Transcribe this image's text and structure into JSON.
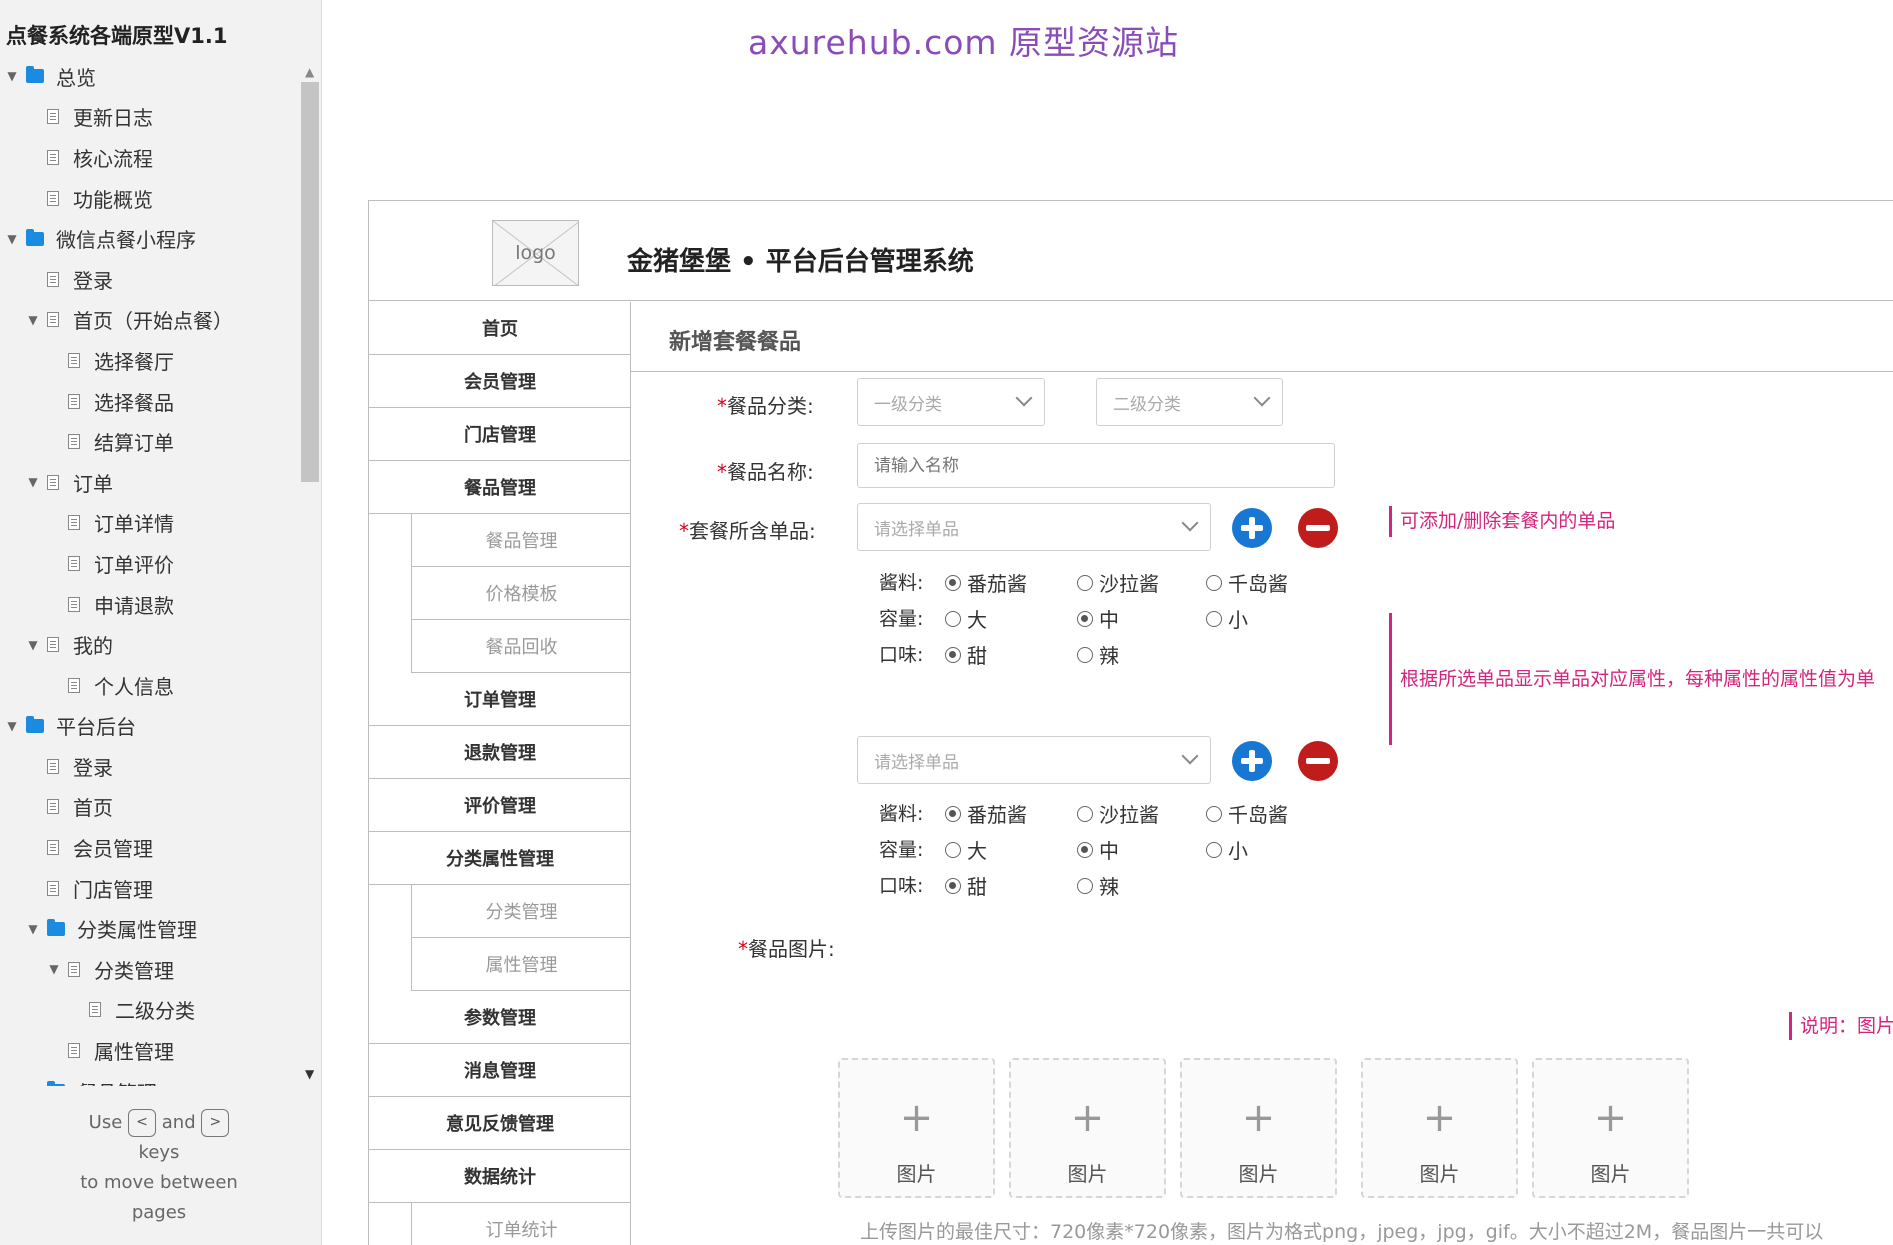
{
  "sitemap": {
    "project_title": "点餐系统各端原型V1.1",
    "nodes": [
      {
        "label": "总览",
        "type": "folder",
        "expanded": true,
        "indent": 0
      },
      {
        "label": "更新日志",
        "type": "page",
        "indent": 1
      },
      {
        "label": "核心流程",
        "type": "page",
        "indent": 1
      },
      {
        "label": "功能概览",
        "type": "page",
        "indent": 1
      },
      {
        "label": "微信点餐小程序",
        "type": "folder",
        "expanded": true,
        "indent": 0
      },
      {
        "label": "登录",
        "type": "page",
        "indent": 1
      },
      {
        "label": "首页（开始点餐）",
        "type": "page",
        "expanded": true,
        "indent": 1
      },
      {
        "label": "选择餐厅",
        "type": "page",
        "indent": 2
      },
      {
        "label": "选择餐品",
        "type": "page",
        "indent": 2
      },
      {
        "label": "结算订单",
        "type": "page",
        "indent": 2
      },
      {
        "label": "订单",
        "type": "page",
        "expanded": true,
        "indent": 1
      },
      {
        "label": "订单详情",
        "type": "page",
        "indent": 2
      },
      {
        "label": "订单评价",
        "type": "page",
        "indent": 2
      },
      {
        "label": "申请退款",
        "type": "page",
        "indent": 2
      },
      {
        "label": "我的",
        "type": "page",
        "expanded": true,
        "indent": 1
      },
      {
        "label": "个人信息",
        "type": "page",
        "indent": 2
      },
      {
        "label": "平台后台",
        "type": "folder",
        "expanded": true,
        "indent": 0
      },
      {
        "label": "登录",
        "type": "page",
        "indent": 1
      },
      {
        "label": "首页",
        "type": "page",
        "indent": 1
      },
      {
        "label": "会员管理",
        "type": "page",
        "indent": 1
      },
      {
        "label": "门店管理",
        "type": "page",
        "indent": 1
      },
      {
        "label": "分类属性管理",
        "type": "folder",
        "expanded": true,
        "indent": 1
      },
      {
        "label": "分类管理",
        "type": "page",
        "expanded": true,
        "indent": 2
      },
      {
        "label": "二级分类",
        "type": "page",
        "indent": 3
      },
      {
        "label": "属性管理",
        "type": "page",
        "indent": 2
      },
      {
        "label": "餐品管理",
        "type": "folder",
        "expanded": true,
        "indent": 1
      }
    ],
    "hint": {
      "use": "Use",
      "and": "and",
      "key_prev": "<",
      "key_next": ">",
      "keys": "keys",
      "to_move": "to move between",
      "pages": "pages"
    }
  },
  "watermark": "axurehub.com 原型资源站",
  "header": {
    "logo_text": "logo",
    "system_title": "金猪堡堡 • 平台后台管理系统"
  },
  "menu": [
    {
      "label": "首页",
      "sub": false
    },
    {
      "label": "会员管理",
      "sub": false
    },
    {
      "label": "门店管理",
      "sub": false
    },
    {
      "label": "餐品管理",
      "sub": false
    },
    {
      "label": "餐品管理",
      "sub": true
    },
    {
      "label": "价格模板",
      "sub": true
    },
    {
      "label": "餐品回收",
      "sub": true
    },
    {
      "label": "订单管理",
      "sub": false
    },
    {
      "label": "退款管理",
      "sub": false
    },
    {
      "label": "评价管理",
      "sub": false
    },
    {
      "label": "分类属性管理",
      "sub": false
    },
    {
      "label": "分类管理",
      "sub": true
    },
    {
      "label": "属性管理",
      "sub": true
    },
    {
      "label": "参数管理",
      "sub": false
    },
    {
      "label": "消息管理",
      "sub": false
    },
    {
      "label": "意见反馈管理",
      "sub": false
    },
    {
      "label": "数据统计",
      "sub": false
    },
    {
      "label": "订单统计",
      "sub": true
    }
  ],
  "form": {
    "page_title": "新增套餐餐品",
    "required_mark": "*",
    "category_label": "餐品分类:",
    "category_level1_placeholder": "一级分类",
    "category_level2_placeholder": "二级分类",
    "name_label": "餐品名称:",
    "name_placeholder": "请输入名称",
    "items_label": "套餐所含单品:",
    "item_select_placeholder": "请选择单品",
    "note_add_remove": "可添加/删除套餐内的单品",
    "note_attributes": "根据所选单品显示单品对应属性，每种属性的属性值为单",
    "attribute_groups": [
      {
        "sauce_label": "酱料:",
        "sauce_options": [
          "番茄酱",
          "沙拉酱",
          "千岛酱"
        ],
        "sauce_selected": 0,
        "size_label": "容量:",
        "size_options": [
          "大",
          "中",
          "小"
        ],
        "size_selected": 1,
        "taste_label": "口味:",
        "taste_options": [
          "甜",
          "辣"
        ],
        "taste_selected": 0
      },
      {
        "sauce_label": "酱料:",
        "sauce_options": [
          "番茄酱",
          "沙拉酱",
          "千岛酱"
        ],
        "sauce_selected": 0,
        "size_label": "容量:",
        "size_options": [
          "大",
          "中",
          "小"
        ],
        "size_selected": 1,
        "taste_label": "口味:",
        "taste_options": [
          "甜",
          "辣"
        ],
        "taste_selected": 0
      }
    ],
    "image_label": "餐品图片:",
    "image_slot_caption": "图片",
    "image_slot_plus": "+",
    "image_slot_count": 5,
    "note_image": "说明：图片",
    "upload_tip": "上传图片的最佳尺寸：720像素*720像素，图片为格式png，jpeg，jpg，gif。大小不超过2M，餐品图片一共可以"
  }
}
